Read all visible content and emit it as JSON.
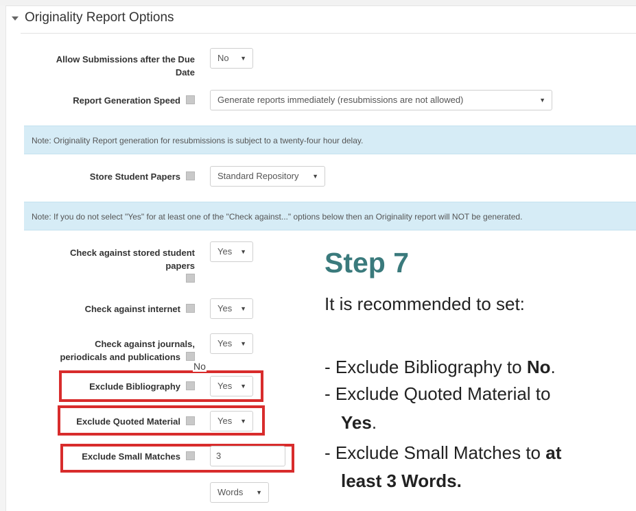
{
  "section": {
    "title": "Originality Report Options"
  },
  "fields": {
    "allow_submissions": {
      "label_line1": "Allow Submissions after the Due",
      "label_line2": "Date",
      "value": "No"
    },
    "report_speed": {
      "label": "Report Generation Speed",
      "value": "Generate reports immediately (resubmissions are not allowed)"
    },
    "store_papers": {
      "label": "Store Student Papers",
      "value": "Standard Repository"
    },
    "check_stored": {
      "label_line1": "Check against stored student",
      "label_line2": "papers",
      "value": "Yes"
    },
    "check_internet": {
      "label": "Check against internet",
      "value": "Yes"
    },
    "check_journals": {
      "label_line1": "Check against journals,",
      "label_line2": "periodicals and publications",
      "value": "Yes"
    },
    "exclude_bibliography": {
      "label": "Exclude Bibliography",
      "value": "Yes",
      "annotation": "No"
    },
    "exclude_quoted": {
      "label": "Exclude Quoted Material",
      "value": "Yes"
    },
    "exclude_small": {
      "label": "Exclude Small Matches",
      "value": "3",
      "unit": "Words"
    }
  },
  "notes": {
    "resubmission": "Note: Originality Report generation for resubmissions is subject to a twenty-four hour delay.",
    "check_against": "Note: If you do not select \"Yes\" for at least one of the \"Check against...\" options below then an Originality report will NOT be generated."
  },
  "instruction": {
    "title": "Step 7",
    "intro": "It is recommended to set:",
    "item1_pre": "- Exclude Bibliography to ",
    "item1_bold": "No",
    "item1_post": ".",
    "item2_line1": "- Exclude Quoted Material to",
    "item2_bold": "Yes",
    "item2_post": ".",
    "item3_pre": "- Exclude Small Matches to ",
    "item3_bold1": "at",
    "item3_bold2": "least 3 Words."
  },
  "colors": {
    "accent": "#3a7a7c",
    "highlight": "#d82c2c",
    "note_bg": "#d6ecf6"
  }
}
